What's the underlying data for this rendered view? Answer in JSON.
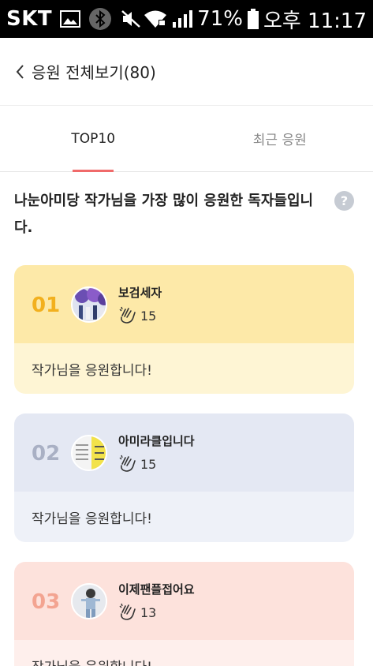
{
  "status_bar": {
    "carrier": "SKT",
    "battery": "71%",
    "time": "오후 11:17"
  },
  "header": {
    "back_icon": "chevron-left-icon",
    "title": "응원 전체보기(80)"
  },
  "tabs": [
    {
      "label": "TOP10",
      "active": true
    },
    {
      "label": "최근 응원",
      "active": false
    }
  ],
  "description": {
    "text": "나눈아미당 작가님을 가장 많이 응원한 독자들입니다.",
    "help_icon": "question-icon"
  },
  "ranking": [
    {
      "rank": "01",
      "name": "보검세자",
      "claps": "15",
      "message": "작가님을 응원합니다!"
    },
    {
      "rank": "02",
      "name": "아미라클입니다",
      "claps": "15",
      "message": "작가님을 응원합니다!"
    },
    {
      "rank": "03",
      "name": "이제팬플접어요",
      "claps": "13",
      "message": "작가님을 응원합니다!"
    }
  ],
  "colors": {
    "tab_indicator": "#f06a6a",
    "rank1_bg": "#fde9a8",
    "rank2_bg": "#e4e8f3",
    "rank3_bg": "#fde2dc"
  }
}
